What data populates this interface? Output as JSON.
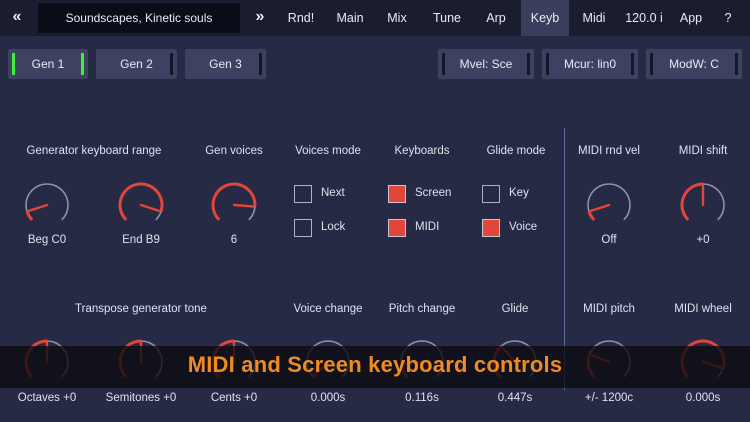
{
  "topbar": {
    "back_label": "«",
    "preset_name": "Soundscapes, Kinetic souls",
    "forward_label": "»",
    "tabs": [
      {
        "label": "Rnd!",
        "active": false
      },
      {
        "label": "Main",
        "active": false
      },
      {
        "label": "Mix",
        "active": false
      },
      {
        "label": "Tune",
        "active": false
      },
      {
        "label": "Arp",
        "active": false
      },
      {
        "label": "Keyb",
        "active": true
      },
      {
        "label": "Midi",
        "active": false
      },
      {
        "label": "120.0 i",
        "active": false
      },
      {
        "label": "App",
        "active": false
      },
      {
        "label": "?",
        "active": false
      }
    ]
  },
  "generators": [
    {
      "label": "Gen 1",
      "selected": true
    },
    {
      "label": "Gen 2",
      "selected": false
    },
    {
      "label": "Gen 3",
      "selected": false
    }
  ],
  "midi_buttons": [
    {
      "label": "Mvel: Sce"
    },
    {
      "label": "Mcur: lin0"
    },
    {
      "label": "ModW: C"
    }
  ],
  "headers": {
    "generator_keyboard_range": "Generator keyboard range",
    "gen_voices": "Gen voices",
    "voices_mode": "Voices mode",
    "keyboards": "Keyboards",
    "glide_mode": "Glide mode",
    "midi_rnd_vel": "MIDI rnd vel",
    "midi_shift": "MIDI shift",
    "transpose_generator_tone": "Transpose generator tone",
    "voice_change": "Voice change",
    "pitch_change": "Pitch change",
    "glide": "Glide",
    "midi_pitch": "MIDI pitch",
    "midi_wheel": "MIDI wheel"
  },
  "knobs_row1": [
    {
      "value": "Beg C0",
      "level": 0.1
    },
    {
      "value": "End B9",
      "level": 0.9
    },
    {
      "value": "6",
      "level": 0.85
    },
    {
      "value": "Off",
      "level": 0.1
    },
    {
      "value": "+0",
      "level": 0.5
    }
  ],
  "knobs_row2": [
    {
      "value": "Octaves +0",
      "level": 0.5
    },
    {
      "value": "Semitones +0",
      "level": 0.5
    },
    {
      "value": "Cents +0",
      "level": 0.5
    },
    {
      "value": "0.000s",
      "level": 0.0
    },
    {
      "value": "0.116s",
      "level": 0.15
    },
    {
      "value": "0.447s",
      "level": 0.35
    },
    {
      "value": "+/- 1200c",
      "level": 0.25
    },
    {
      "value": "0.000s",
      "level": 0.9
    }
  ],
  "voices_mode": [
    {
      "label": "Next",
      "checked": false
    },
    {
      "label": "Lock",
      "checked": false
    }
  ],
  "keyboards": [
    {
      "label": "Screen",
      "checked": true
    },
    {
      "label": "MIDI",
      "checked": true
    }
  ],
  "glide_mode": [
    {
      "label": "Key",
      "checked": false
    },
    {
      "label": "Voice",
      "checked": true
    }
  ],
  "caption": "MIDI and Screen keyboard controls",
  "colors": {
    "background": "#262a44",
    "knob_accent": "#e2463a",
    "selected_indicator": "#3ff03a",
    "caption": "#f08a24"
  }
}
